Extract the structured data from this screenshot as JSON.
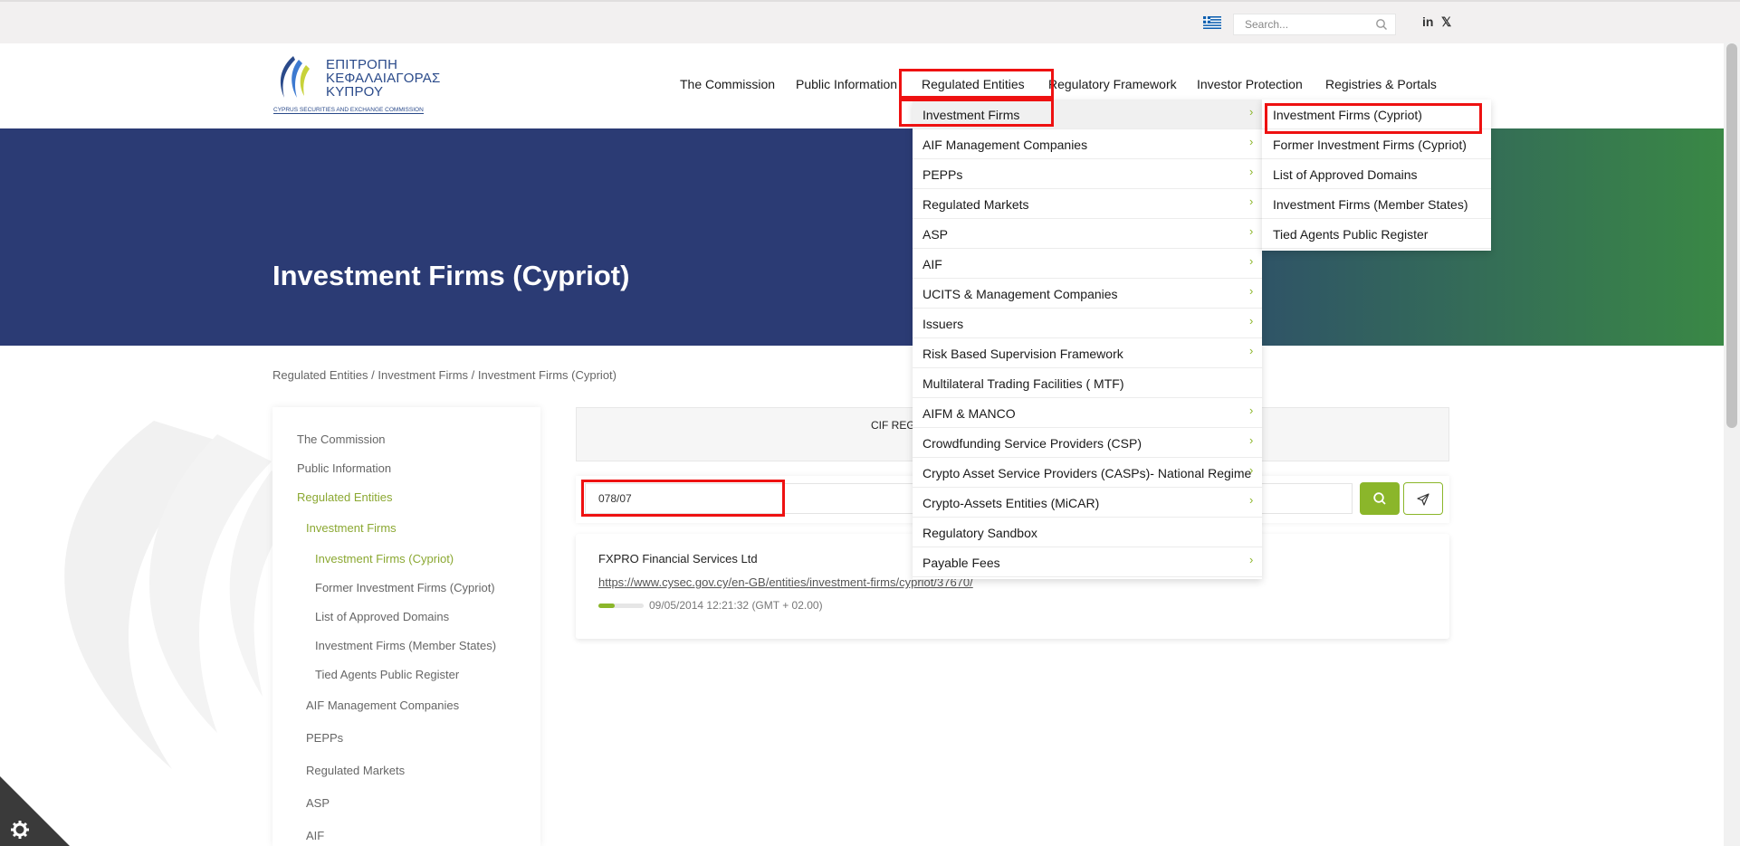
{
  "topbar": {
    "search_placeholder": "Search...",
    "linkedin": "in",
    "x": "𝕏"
  },
  "logo": {
    "line1": "ΕΠΙΤΡΟΠΗ",
    "line2": "ΚΕΦΑΛΑΙΑΓΟΡΑΣ",
    "line3": "ΚΥΠΡΟΥ",
    "sub": "CYPRUS SECURITIES AND EXCHANGE COMMISSION"
  },
  "nav": [
    "The Commission",
    "Public Information",
    "Regulated Entities",
    "Regulatory Framework",
    "Investor Protection",
    "Registries & Portals"
  ],
  "hero": {
    "title": "Investment Firms (Cypriot)"
  },
  "breadcrumb": "Regulated Entities / Investment Firms / Investment Firms (Cypriot)",
  "sidebar": {
    "items": [
      {
        "label": "The Commission",
        "active": false
      },
      {
        "label": "Public Information",
        "active": false
      },
      {
        "label": "Regulated Entities",
        "active": true
      },
      {
        "label": "Investment Firms",
        "active": true
      },
      {
        "label": "Investment Firms (Cypriot)",
        "active": true
      },
      {
        "label": "Former Investment Firms (Cypriot)",
        "active": false
      },
      {
        "label": "List of Approved Domains",
        "active": false
      },
      {
        "label": "Investment Firms (Member States)",
        "active": false
      },
      {
        "label": "Tied Agents Public Register",
        "active": false
      },
      {
        "label": "AIF Management Companies",
        "active": false
      },
      {
        "label": "PEPPs",
        "active": false
      },
      {
        "label": "Regulated Markets",
        "active": false
      },
      {
        "label": "ASP",
        "active": false
      },
      {
        "label": "AIF",
        "active": false
      }
    ]
  },
  "main": {
    "cif_label": "CIF REG",
    "search_value": "078/07",
    "result": {
      "title": "FXPRO Financial Services Ltd",
      "link": "https://www.cysec.gov.cy/en-GB/entities/investment-firms/cypriot/37670/",
      "date": "09/05/2014 12:21:32 (GMT + 02.00)",
      "relevance": 0.35
    }
  },
  "dropdown": {
    "items": [
      {
        "label": "Investment Firms",
        "chevron": true
      },
      {
        "label": "AIF Management Companies",
        "chevron": true
      },
      {
        "label": "PEPPs",
        "chevron": true
      },
      {
        "label": "Regulated Markets",
        "chevron": true
      },
      {
        "label": "ASP",
        "chevron": true
      },
      {
        "label": "AIF",
        "chevron": true
      },
      {
        "label": "UCITS & Management Companies",
        "chevron": true
      },
      {
        "label": "Issuers",
        "chevron": true
      },
      {
        "label": "Risk Based Supervision Framework",
        "chevron": true
      },
      {
        "label": "Multilateral Trading Facilities ( MTF)",
        "chevron": false
      },
      {
        "label": "AIFM & MANCO",
        "chevron": true
      },
      {
        "label": "Crowdfunding Service Providers (CSP)",
        "chevron": true
      },
      {
        "label": "Crypto Asset Service Providers (CASPs)- National Regime",
        "chevron": true
      },
      {
        "label": "Crypto-Assets Entities (MiCAR)",
        "chevron": true
      },
      {
        "label": "Regulatory Sandbox",
        "chevron": false
      },
      {
        "label": "Payable Fees",
        "chevron": true
      }
    ],
    "sub_items": [
      "Investment Firms (Cypriot)",
      "Former Investment Firms (Cypriot)",
      "List of Approved Domains",
      "Investment Firms (Member States)",
      "Tied Agents Public Register"
    ]
  },
  "colors": {
    "accent": "#8bb62a",
    "hero": "#2b3b74",
    "highlight_box": "#ee1111"
  }
}
